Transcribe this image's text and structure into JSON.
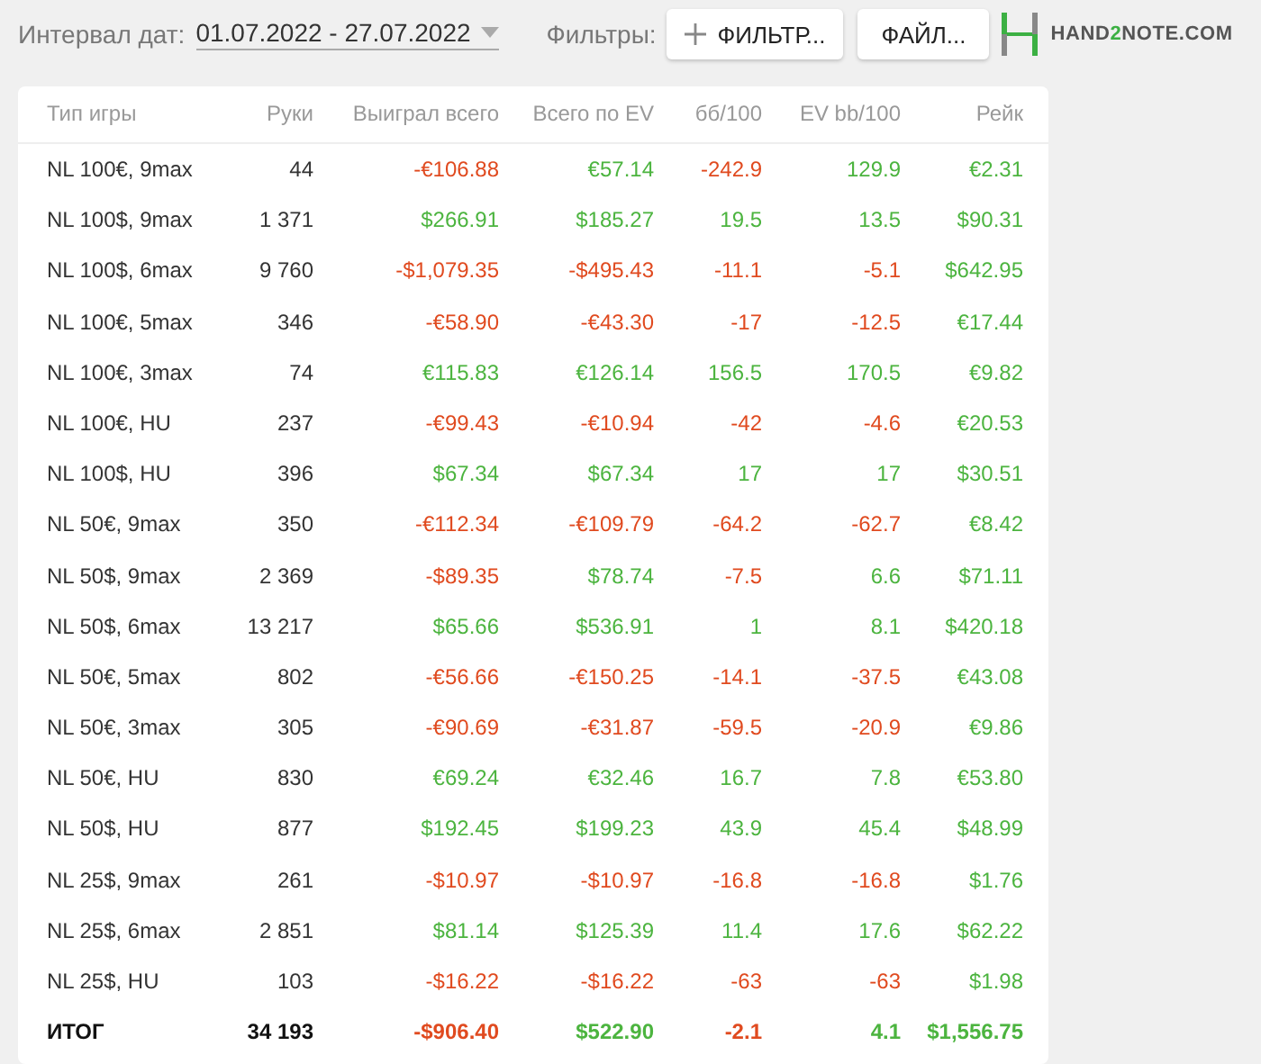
{
  "toolbar": {
    "date_label": "Интервал дат:",
    "date_range": "01.07.2022 - 27.07.2022",
    "filters_label": "Фильтры:",
    "filter_button": "ФИЛЬТР...",
    "file_button": "ФАЙЛ...",
    "logo": {
      "before": "HAND",
      "accent": "2",
      "after": "NOTE.COM"
    }
  },
  "table": {
    "columns": [
      "Тип игры",
      "Руки",
      "Выиграл всего",
      "Всего по EV",
      "бб/100",
      "EV bb/100",
      "Рейк"
    ],
    "rows": [
      {
        "game": "NL 100€, 9max",
        "hands": "44",
        "values": [
          {
            "text": "-€106.88",
            "color": "#e04a1f"
          },
          {
            "text": "€57.14",
            "color": "#4cb43f"
          },
          {
            "text": "-242.9",
            "color": "#e04a1f"
          },
          {
            "text": "129.9",
            "color": "#4cb43f"
          },
          {
            "text": "€2.31",
            "color": "#4cb43f"
          }
        ]
      },
      {
        "game": "NL 100$, 9max",
        "hands": "1 371",
        "values": [
          {
            "text": "$266.91",
            "color": "#4cb43f"
          },
          {
            "text": "$185.27",
            "color": "#4cb43f"
          },
          {
            "text": "19.5",
            "color": "#4cb43f"
          },
          {
            "text": "13.5",
            "color": "#4cb43f"
          },
          {
            "text": "$90.31",
            "color": "#4cb43f"
          }
        ]
      },
      {
        "game": "NL 100$, 6max",
        "hands": "9 760",
        "values": [
          {
            "text": "-$1,079.35",
            "color": "#e04a1f"
          },
          {
            "text": "-$495.43",
            "color": "#e04a1f"
          },
          {
            "text": "-11.1",
            "color": "#e04a1f"
          },
          {
            "text": "-5.1",
            "color": "#e04a1f"
          },
          {
            "text": "$642.95",
            "color": "#4cb43f"
          }
        ]
      },
      {
        "game": "NL 100€, 5max",
        "hands": "346",
        "values": [
          {
            "text": "-€58.90",
            "color": "#e04a1f"
          },
          {
            "text": "-€43.30",
            "color": "#e04a1f"
          },
          {
            "text": "-17",
            "color": "#e04a1f"
          },
          {
            "text": "-12.5",
            "color": "#e04a1f"
          },
          {
            "text": "€17.44",
            "color": "#4cb43f"
          }
        ]
      },
      {
        "game": "NL 100€, 3max",
        "hands": "74",
        "values": [
          {
            "text": "€115.83",
            "color": "#4cb43f"
          },
          {
            "text": "€126.14",
            "color": "#4cb43f"
          },
          {
            "text": "156.5",
            "color": "#4cb43f"
          },
          {
            "text": "170.5",
            "color": "#4cb43f"
          },
          {
            "text": "€9.82",
            "color": "#4cb43f"
          }
        ]
      },
      {
        "game": "NL 100€, HU",
        "hands": "237",
        "values": [
          {
            "text": "-€99.43",
            "color": "#e04a1f"
          },
          {
            "text": "-€10.94",
            "color": "#e04a1f"
          },
          {
            "text": "-42",
            "color": "#e04a1f"
          },
          {
            "text": "-4.6",
            "color": "#e04a1f"
          },
          {
            "text": "€20.53",
            "color": "#4cb43f"
          }
        ]
      },
      {
        "game": "NL 100$, HU",
        "hands": "396",
        "values": [
          {
            "text": "$67.34",
            "color": "#4cb43f"
          },
          {
            "text": "$67.34",
            "color": "#4cb43f"
          },
          {
            "text": "17",
            "color": "#4cb43f"
          },
          {
            "text": "17",
            "color": "#4cb43f"
          },
          {
            "text": "$30.51",
            "color": "#4cb43f"
          }
        ]
      },
      {
        "game": "NL 50€, 9max",
        "hands": "350",
        "values": [
          {
            "text": "-€112.34",
            "color": "#e04a1f"
          },
          {
            "text": "-€109.79",
            "color": "#e04a1f"
          },
          {
            "text": "-64.2",
            "color": "#e04a1f"
          },
          {
            "text": "-62.7",
            "color": "#e04a1f"
          },
          {
            "text": "€8.42",
            "color": "#4cb43f"
          }
        ]
      },
      {
        "game": "NL 50$, 9max",
        "hands": "2 369",
        "values": [
          {
            "text": "-$89.35",
            "color": "#e04a1f"
          },
          {
            "text": "$78.74",
            "color": "#4cb43f"
          },
          {
            "text": "-7.5",
            "color": "#e04a1f"
          },
          {
            "text": "6.6",
            "color": "#4cb43f"
          },
          {
            "text": "$71.11",
            "color": "#4cb43f"
          }
        ]
      },
      {
        "game": "NL 50$, 6max",
        "hands": "13 217",
        "values": [
          {
            "text": "$65.66",
            "color": "#4cb43f"
          },
          {
            "text": "$536.91",
            "color": "#4cb43f"
          },
          {
            "text": "1",
            "color": "#4cb43f"
          },
          {
            "text": "8.1",
            "color": "#4cb43f"
          },
          {
            "text": "$420.18",
            "color": "#4cb43f"
          }
        ]
      },
      {
        "game": "NL 50€, 5max",
        "hands": "802",
        "values": [
          {
            "text": "-€56.66",
            "color": "#e04a1f"
          },
          {
            "text": "-€150.25",
            "color": "#e04a1f"
          },
          {
            "text": "-14.1",
            "color": "#e04a1f"
          },
          {
            "text": "-37.5",
            "color": "#e04a1f"
          },
          {
            "text": "€43.08",
            "color": "#4cb43f"
          }
        ]
      },
      {
        "game": "NL 50€, 3max",
        "hands": "305",
        "values": [
          {
            "text": "-€90.69",
            "color": "#e04a1f"
          },
          {
            "text": "-€31.87",
            "color": "#e04a1f"
          },
          {
            "text": "-59.5",
            "color": "#e04a1f"
          },
          {
            "text": "-20.9",
            "color": "#e04a1f"
          },
          {
            "text": "€9.86",
            "color": "#4cb43f"
          }
        ]
      },
      {
        "game": "NL 50€, HU",
        "hands": "830",
        "values": [
          {
            "text": "€69.24",
            "color": "#4cb43f"
          },
          {
            "text": "€32.46",
            "color": "#4cb43f"
          },
          {
            "text": "16.7",
            "color": "#4cb43f"
          },
          {
            "text": "7.8",
            "color": "#4cb43f"
          },
          {
            "text": "€53.80",
            "color": "#4cb43f"
          }
        ]
      },
      {
        "game": "NL 50$, HU",
        "hands": "877",
        "values": [
          {
            "text": "$192.45",
            "color": "#4cb43f"
          },
          {
            "text": "$199.23",
            "color": "#4cb43f"
          },
          {
            "text": "43.9",
            "color": "#4cb43f"
          },
          {
            "text": "45.4",
            "color": "#4cb43f"
          },
          {
            "text": "$48.99",
            "color": "#4cb43f"
          }
        ]
      },
      {
        "game": "NL 25$, 9max",
        "hands": "261",
        "values": [
          {
            "text": "-$10.97",
            "color": "#e04a1f"
          },
          {
            "text": "-$10.97",
            "color": "#e04a1f"
          },
          {
            "text": "-16.8",
            "color": "#e04a1f"
          },
          {
            "text": "-16.8",
            "color": "#e04a1f"
          },
          {
            "text": "$1.76",
            "color": "#4cb43f"
          }
        ]
      },
      {
        "game": "NL 25$, 6max",
        "hands": "2 851",
        "values": [
          {
            "text": "$81.14",
            "color": "#4cb43f"
          },
          {
            "text": "$125.39",
            "color": "#4cb43f"
          },
          {
            "text": "11.4",
            "color": "#4cb43f"
          },
          {
            "text": "17.6",
            "color": "#4cb43f"
          },
          {
            "text": "$62.22",
            "color": "#4cb43f"
          }
        ]
      },
      {
        "game": "NL 25$, HU",
        "hands": "103",
        "values": [
          {
            "text": "-$16.22",
            "color": "#e04a1f"
          },
          {
            "text": "-$16.22",
            "color": "#e04a1f"
          },
          {
            "text": "-63",
            "color": "#e04a1f"
          },
          {
            "text": "-63",
            "color": "#e04a1f"
          },
          {
            "text": "$1.98",
            "color": "#4cb43f"
          }
        ]
      }
    ],
    "total": {
      "game": "ИТОГ",
      "hands": "34 193",
      "values": [
        {
          "text": "-$906.40",
          "color": "#e04a1f"
        },
        {
          "text": "$522.90",
          "color": "#4cb43f"
        },
        {
          "text": "-2.1",
          "color": "#e04a1f"
        },
        {
          "text": "4.1",
          "color": "#4cb43f"
        },
        {
          "text": "$1,556.75",
          "color": "#4cb43f"
        }
      ]
    }
  }
}
